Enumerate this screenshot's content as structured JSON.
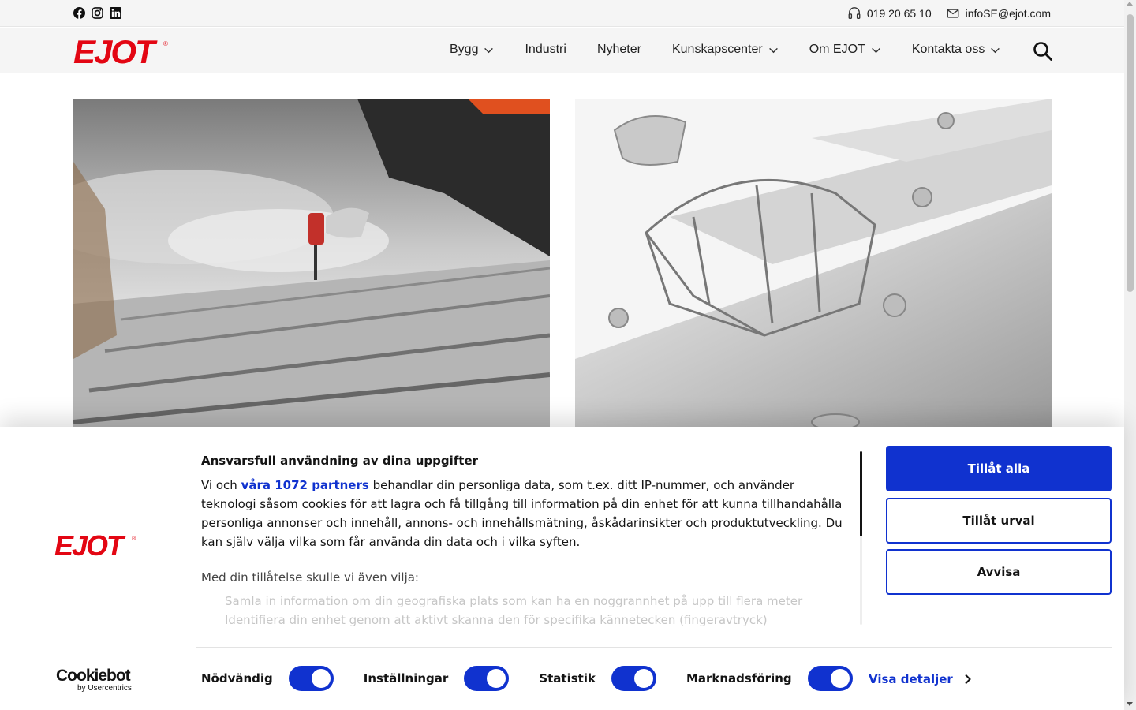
{
  "topbar": {
    "social_icons": [
      "facebook-icon",
      "instagram-icon",
      "linkedin-icon"
    ],
    "phone": "019 20 65 10",
    "email": "infoSE@ejot.com"
  },
  "header": {
    "logo_text": "EJOT",
    "nav": [
      {
        "label": "Bygg",
        "has_dropdown": true
      },
      {
        "label": "Industri",
        "has_dropdown": false
      },
      {
        "label": "Nyheter",
        "has_dropdown": false
      },
      {
        "label": "Kunskapscenter",
        "has_dropdown": true
      },
      {
        "label": "Om EJOT",
        "has_dropdown": true
      },
      {
        "label": "Kontakta oss",
        "has_dropdown": true
      }
    ]
  },
  "cookie_banner": {
    "logo_text": "EJOT",
    "title": "Ansvarsfull användning av dina uppgifter",
    "text_before": "Vi och ",
    "partners_link": "våra 1072 partners",
    "text_after": " behandlar din personliga data, som t.ex. ditt IP-nummer, och använder teknologi såsom cookies för att lagra och få tillgång till information på din enhet för att kunna tillhandahålla personliga annonser och innehåll, annons- och innehållsmätning, åskådarinsikter och produktutveckling. Du kan själv välja vilka som får använda din data och i vilka syften.",
    "subheading": "Med din tillåtelse skulle vi även vilja:",
    "bullets": [
      "Samla in information om din geografiska plats som kan ha en noggrannhet på upp till flera meter",
      "Identifiera din enhet genom att aktivt skanna den för specifika kännetecken (fingeravtryck)"
    ],
    "buttons": {
      "allow_all": "Tillåt alla",
      "allow_selection": "Tillåt urval",
      "deny": "Avvisa"
    },
    "toggles": [
      {
        "label": "Nödvändig",
        "on": true
      },
      {
        "label": "Inställningar",
        "on": true
      },
      {
        "label": "Statistik",
        "on": true
      },
      {
        "label": "Marknadsföring",
        "on": true
      }
    ],
    "details_link": "Visa detaljer",
    "cookiebot_name": "Cookiebot",
    "cookiebot_by": "by Usercentrics"
  },
  "colors": {
    "brand_red": "#e30613",
    "accent_blue": "#1032cf"
  }
}
